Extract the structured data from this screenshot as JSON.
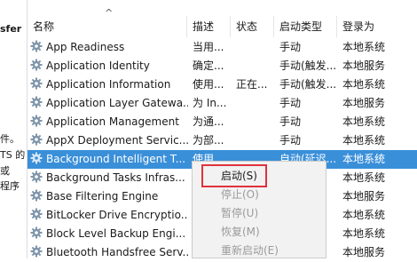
{
  "left_pane": {
    "fragments": [
      "sfer",
      "件。",
      "TS 的",
      "或",
      "程序"
    ]
  },
  "columns": [
    "名称",
    "描述",
    "状态",
    "启动类型",
    "登录为"
  ],
  "sort_indicator": "^",
  "services": [
    {
      "name": "App Readiness",
      "desc": "当用...",
      "status": "",
      "startup": "手动",
      "logon": "本地系统"
    },
    {
      "name": "Application Identity",
      "desc": "确定...",
      "status": "",
      "startup": "手动(触发...",
      "logon": "本地服务"
    },
    {
      "name": "Application Information",
      "desc": "使用...",
      "status": "正在...",
      "startup": "手动(触发...",
      "logon": "本地系统"
    },
    {
      "name": "Application Layer Gatewa...",
      "desc": "为 In...",
      "status": "",
      "startup": "手动",
      "logon": "本地服务"
    },
    {
      "name": "Application Management",
      "desc": "为通...",
      "status": "",
      "startup": "手动",
      "logon": "本地系统"
    },
    {
      "name": "AppX Deployment Servic...",
      "desc": "为部...",
      "status": "",
      "startup": "手动",
      "logon": "本地系统"
    },
    {
      "name": "Background Intelligent T...",
      "desc": "使用...",
      "status": "",
      "startup": "自动(延迟...",
      "logon": "本地系统"
    },
    {
      "name": "Background Tasks Infras...",
      "desc": "",
      "status": "",
      "startup": "",
      "logon": "本地系统"
    },
    {
      "name": "Base Filtering Engine",
      "desc": "",
      "status": "",
      "startup": "",
      "logon": "本地服务"
    },
    {
      "name": "BitLocker Drive Encryptio...",
      "desc": "",
      "status": "",
      "startup": "",
      "logon": "本地系统"
    },
    {
      "name": "Block Level Backup Engi...",
      "desc": "",
      "status": "",
      "startup": "",
      "logon": "本地系统"
    },
    {
      "name": "Bluetooth Handsfree Serv...",
      "desc": "",
      "status": "",
      "startup": "",
      "logon": "本地服务"
    }
  ],
  "selected_row": "Background Intelligent T...",
  "context_menu": {
    "items": [
      {
        "label": "启动(S)",
        "enabled": true
      },
      {
        "label": "停止(O)",
        "enabled": false
      },
      {
        "label": "暂停(U)",
        "enabled": false
      },
      {
        "label": "恢复(M)",
        "enabled": false
      },
      {
        "label": "重新启动(E)",
        "enabled": false
      }
    ]
  },
  "colors": {
    "selection": "#3a8fd9",
    "highlight_box": "#e0323c",
    "menu_bg": "#f2f2f2",
    "disabled_text": "#9b9b9b"
  },
  "icons": {
    "service_icon": "gear-service-icon"
  }
}
